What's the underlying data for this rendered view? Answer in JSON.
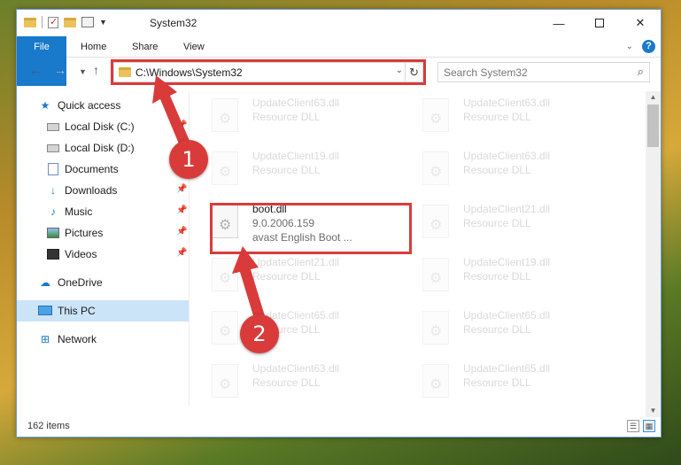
{
  "window": {
    "title": "System32",
    "minimize_glyph": "—",
    "close_glyph": "✕"
  },
  "ribbon": {
    "tabs": [
      {
        "label": "File"
      },
      {
        "label": "Home"
      },
      {
        "label": "Share"
      },
      {
        "label": "View"
      }
    ],
    "expand_glyph": "⌄",
    "help_label": "?"
  },
  "nav": {
    "back_glyph": "←",
    "forward_glyph": "→",
    "recent_glyph": "▼",
    "up_glyph": "↑",
    "address": "C:\\Windows\\System32",
    "address_dropdown_glyph": "⌄",
    "refresh_glyph": "↻",
    "search_placeholder": "Search System32",
    "search_glyph": "⌕"
  },
  "sidebar": {
    "items": [
      {
        "label": "Quick access",
        "icon": "star-icon",
        "glyph": "★"
      },
      {
        "label": "Local Disk (C:)",
        "icon": "drive-icon",
        "pinned": true
      },
      {
        "label": "Local Disk (D:)",
        "icon": "drive-icon",
        "pinned": false
      },
      {
        "label": "Documents",
        "icon": "documents-icon",
        "pinned": true
      },
      {
        "label": "Downloads",
        "icon": "download-icon",
        "glyph": "↓",
        "pinned": true
      },
      {
        "label": "Music",
        "icon": "music-icon",
        "glyph": "♪",
        "pinned": true
      },
      {
        "label": "Pictures",
        "icon": "pictures-icon",
        "pinned": true
      },
      {
        "label": "Videos",
        "icon": "videos-icon",
        "pinned": true
      },
      {
        "label": "OneDrive",
        "icon": "cloud-icon",
        "glyph": "☁"
      },
      {
        "label": "This PC",
        "icon": "computer-icon",
        "selected": true
      },
      {
        "label": "Network",
        "icon": "network-icon",
        "glyph": "⊞"
      }
    ],
    "pin_glyph": "📌"
  },
  "files": [
    {
      "name": "UpdateClient63.dll",
      "type": "Resource DLL"
    },
    {
      "name": "UpdateClient63.dll",
      "type": "Resource DLL"
    },
    {
      "name": "UpdateClient19.dll",
      "type": "Resource DLL"
    },
    {
      "name": "UpdateClient63.dll",
      "type": "Resource DLL"
    },
    {
      "name": "boot.dll",
      "version": "9.0.2006.159",
      "description": "avast English Boot ..."
    },
    {
      "name": "UpdateClient21.dll",
      "type": "Resource DLL"
    },
    {
      "name": "UpdateClient21.dll",
      "type": "Resource DLL"
    },
    {
      "name": "UpdateClient19.dll",
      "type": "Resource DLL"
    },
    {
      "name": "UpdateClient65.dll",
      "type": "Resource DLL"
    },
    {
      "name": "UpdateClient65.dll",
      "type": "Resource DLL"
    },
    {
      "name": "UpdateClient63.dll",
      "type": "Resource DLL"
    },
    {
      "name": "UpdateClient65.dll",
      "type": "Resource DLL"
    }
  ],
  "status": {
    "item_count": "162 items",
    "details_view_glyph": "☰",
    "tiles_view_glyph": "▦"
  },
  "callouts": {
    "step1": "1",
    "step2": "2",
    "color": "#d93b3b"
  },
  "colors": {
    "accent": "#1979ca",
    "selected_bg": "#cce4f7"
  }
}
